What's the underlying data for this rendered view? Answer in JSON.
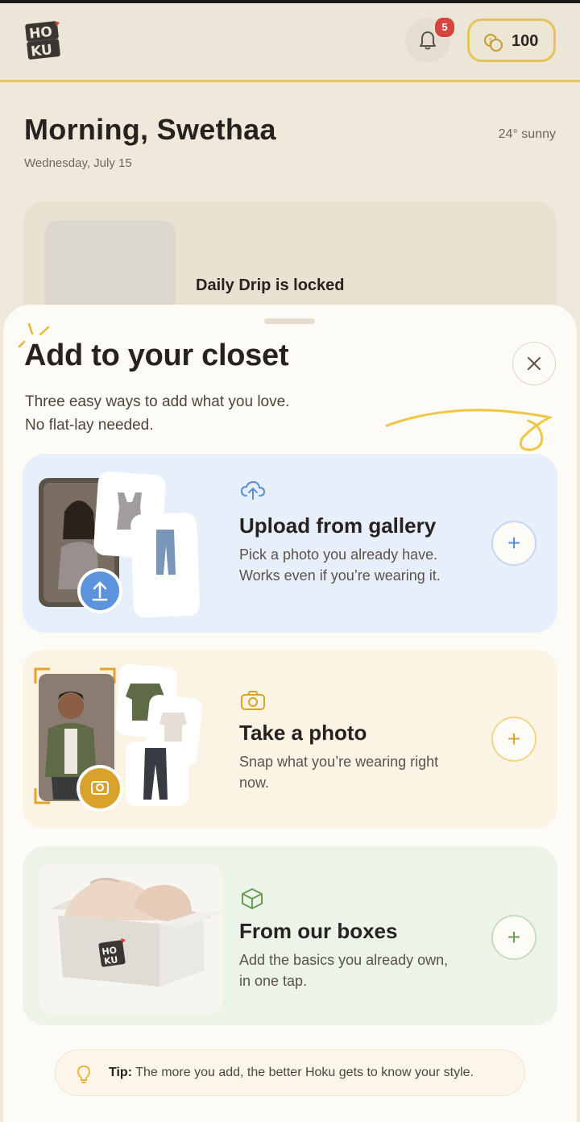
{
  "app": {
    "logo_text": "HOKU",
    "notifications_count": "5",
    "coins": "100",
    "greeting": "Morning, Swethaa",
    "date": "Wednesday, July 15",
    "weather": "24° sunny",
    "daily_drip_status": "Daily Drip is locked"
  },
  "sheet": {
    "title": "Add to your closet",
    "subtitle_line1": "Three easy ways to add what you love.",
    "subtitle_line2": "No flat-lay needed.",
    "options": [
      {
        "title": "Upload from gallery",
        "description": "Pick a photo you already have. Works even if you’re wearing it.",
        "icon": "cloud-upload-icon",
        "accent": "#5a8fd6"
      },
      {
        "title": "Take a photo",
        "description": "Snap what you’re wearing right now.",
        "icon": "camera-icon",
        "accent": "#d8a52c"
      },
      {
        "title": "From our boxes",
        "description": "Add the basics you already own, in one tap.",
        "icon": "box-icon",
        "accent": "#6a9a55"
      }
    ],
    "tip_label": "Tip:",
    "tip_text": "The more you add, the better Hoku gets to know your style."
  },
  "colors": {
    "brand_yellow": "#e6c25a",
    "blue_card": "#e7effa",
    "yellow_card": "#fbf4e4",
    "green_card": "#ecf3e8"
  }
}
